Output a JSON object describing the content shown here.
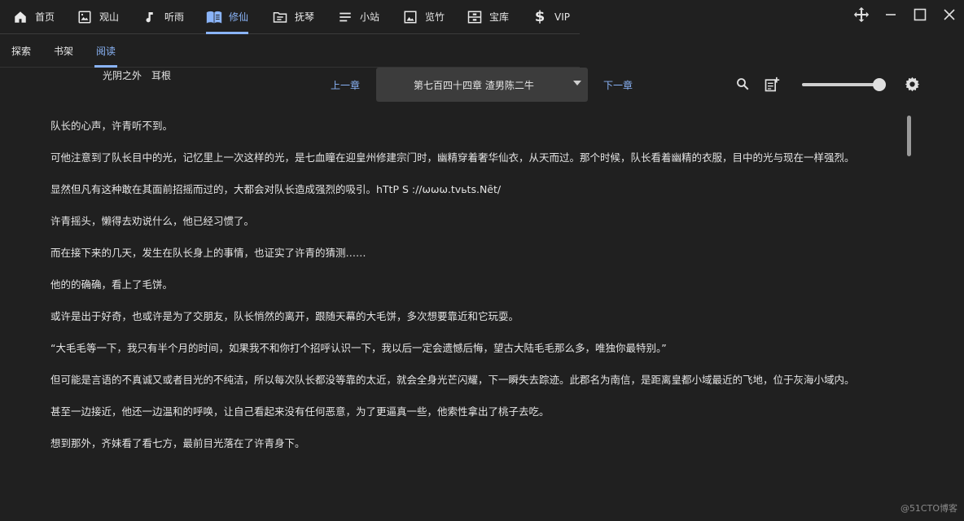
{
  "nav": [
    {
      "label": "首页",
      "icon": "home-icon"
    },
    {
      "label": "观山",
      "icon": "image-icon"
    },
    {
      "label": "听雨",
      "icon": "music-note-icon"
    },
    {
      "label": "修仙",
      "icon": "book-open-icon",
      "active": true
    },
    {
      "label": "抚琴",
      "icon": "folder-icon"
    },
    {
      "label": "小站",
      "icon": "list-icon"
    },
    {
      "label": "览竹",
      "icon": "picture-icon"
    },
    {
      "label": "宝库",
      "icon": "archive-icon"
    },
    {
      "label": "VIP",
      "icon": "dollar-icon"
    }
  ],
  "subtabs": [
    "探索",
    "书架",
    "阅读"
  ],
  "book": {
    "title": "光阴之外",
    "author": "耳根"
  },
  "reader": {
    "prev_label": "上一章",
    "next_label": "下一章",
    "chapter": "第七百四十四章 渣男陈二牛",
    "font_size_fraction": 0.97
  },
  "paragraphs": [
    "队长的心声，许青听不到。",
    "可他注意到了队长目中的光，记忆里上一次这样的光，是七血瞳在迎皇州修建宗门时，幽精穿着奢华仙衣，从天而过。那个时候，队长看着幽精的衣服，目中的光与现在一样强烈。",
    "显然但凡有这种敢在其面前招摇而过的，大都会对队长造成强烈的吸引。hTtP S ://ωωω.tvьts.Nēt/",
    "许青摇头，懒得去劝说什么，他已经习惯了。",
    "而在接下来的几天，发生在队长身上的事情，也证实了许青的猜测……",
    "他的的确确，看上了毛饼。",
    "或许是出于好奇，也或许是为了交朋友，队长悄然的离开，跟随天幕的大毛饼，多次想要靠近和它玩耍。",
    "“大毛毛等一下，我只有半个月的时间，如果我不和你打个招呼认识一下，我以后一定会遗憾后悔，望古大陆毛毛那么多，唯独你最特别。”",
    "但可能是言语的不真诚又或者目光的不纯洁，所以每次队长都没等靠的太近，就会全身光芒闪耀，下一瞬失去踪迹。此郡名为南信，是距离皇都小域最近的飞地，位于灰海小域内。",
    "甚至一边接近，他还一边温和的呼唤，让自己看起来没有任何恶意，为了更逼真一些，他索性拿出了桃子去吃。",
    "想到那外，齐妹看了看七方，最前目光落在了许青身下。"
  ],
  "watermark": "@51CTO博客",
  "accent": "#8ab4f8"
}
